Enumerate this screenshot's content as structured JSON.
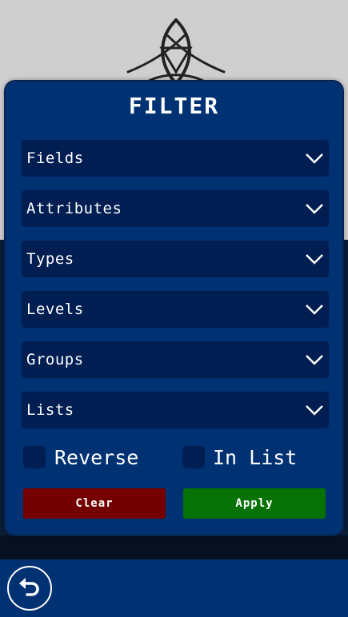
{
  "title": "FILTER",
  "dropdowns": [
    {
      "label": "Fields"
    },
    {
      "label": "Attributes"
    },
    {
      "label": "Types"
    },
    {
      "label": "Levels"
    },
    {
      "label": "Groups"
    },
    {
      "label": "Lists"
    }
  ],
  "checkboxes": {
    "reverse": {
      "label": "Reverse",
      "checked": false
    },
    "in_list": {
      "label": "In List",
      "checked": false
    }
  },
  "buttons": {
    "clear": "Clear",
    "apply": "Apply"
  },
  "icons": {
    "dropdown_arrow": "chevron-down-icon",
    "back": "undo-arrow-icon",
    "emblem": "emblem-logo"
  },
  "colors": {
    "panel": "#003172",
    "field": "#001e52",
    "clear": "#750000",
    "apply": "#067205"
  }
}
